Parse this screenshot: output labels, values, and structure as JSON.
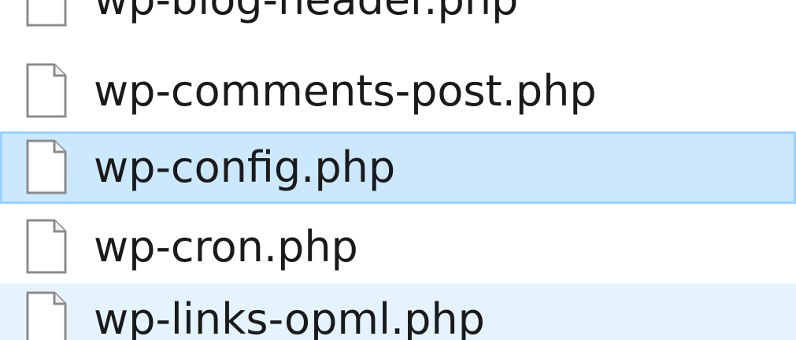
{
  "file_list": {
    "items": [
      {
        "name": "wp-blog-header.php",
        "icon": "file-icon",
        "state": "normal"
      },
      {
        "name": "wp-comments-post.php",
        "icon": "file-icon",
        "state": "normal"
      },
      {
        "name": "wp-config.php",
        "icon": "file-icon",
        "state": "selected"
      },
      {
        "name": "wp-cron.php",
        "icon": "file-icon",
        "state": "normal"
      },
      {
        "name": "wp-links-opml.php",
        "icon": "file-icon",
        "state": "hover"
      }
    ]
  },
  "colors": {
    "selected_bg": "#cce8ff",
    "selected_border": "#99d1ff",
    "hover_bg": "#e5f3ff",
    "text": "#1a1a1a"
  }
}
